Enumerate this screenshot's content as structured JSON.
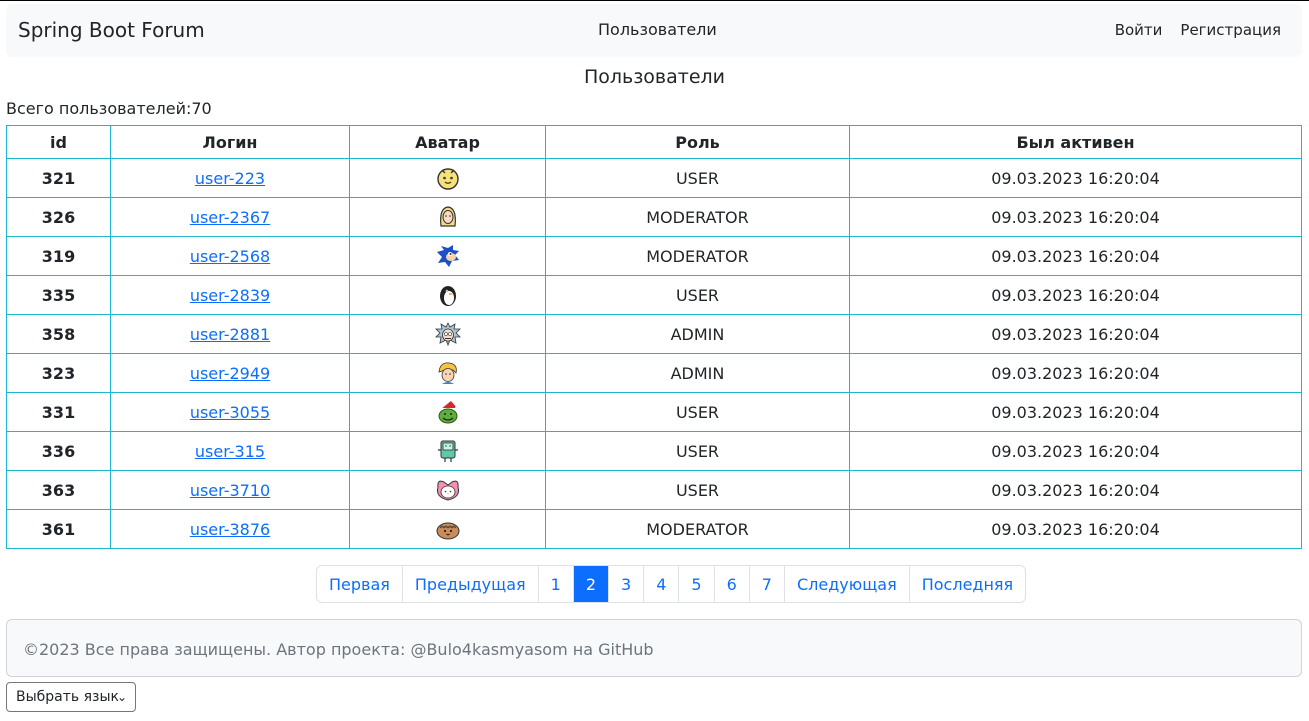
{
  "navbar": {
    "brand": "Spring Boot Forum",
    "center_link": "Пользователи",
    "login": "Войти",
    "register": "Регистрация"
  },
  "page": {
    "title": "Пользователи",
    "total": "Всего пользователей:70"
  },
  "table": {
    "headers": [
      "id",
      "Логин",
      "Аватар",
      "Роль",
      "Был активен"
    ],
    "rows": [
      {
        "id": "321",
        "login": "user-223",
        "avatar": "bt21-chimmy-icon",
        "role": "USER",
        "active": "09.03.2023 16:20:04"
      },
      {
        "id": "326",
        "login": "user-2367",
        "avatar": "blonde-girl-icon",
        "role": "MODERATOR",
        "active": "09.03.2023 16:20:04"
      },
      {
        "id": "319",
        "login": "user-2568",
        "avatar": "sonic-icon",
        "role": "MODERATOR",
        "active": "09.03.2023 16:20:04"
      },
      {
        "id": "335",
        "login": "user-2839",
        "avatar": "penguin-icon",
        "role": "USER",
        "active": "09.03.2023 16:20:04"
      },
      {
        "id": "358",
        "login": "user-2881",
        "avatar": "rick-icon",
        "role": "ADMIN",
        "active": "09.03.2023 16:20:04"
      },
      {
        "id": "323",
        "login": "user-2949",
        "avatar": "blonde-boy-icon",
        "role": "ADMIN",
        "active": "09.03.2023 16:20:04"
      },
      {
        "id": "331",
        "login": "user-3055",
        "avatar": "grinch-icon",
        "role": "USER",
        "active": "09.03.2023 16:20:04"
      },
      {
        "id": "336",
        "login": "user-315",
        "avatar": "bmo-icon",
        "role": "USER",
        "active": "09.03.2023 16:20:04"
      },
      {
        "id": "363",
        "login": "user-3710",
        "avatar": "my-melody-icon",
        "role": "USER",
        "active": "09.03.2023 16:20:04"
      },
      {
        "id": "361",
        "login": "user-3876",
        "avatar": "bt21-shooky-icon",
        "role": "MODERATOR",
        "active": "09.03.2023 16:20:04"
      }
    ]
  },
  "pagination": {
    "first": "Первая",
    "prev": "Предыдущая",
    "pages": [
      "1",
      "2",
      "3",
      "4",
      "5",
      "6",
      "7"
    ],
    "current": "2",
    "next": "Следующая",
    "last": "Последняя"
  },
  "footer": {
    "text": "©2023 Все права защищены. Автор проекта: @Bulo4kasmyasom на GitHub"
  },
  "language_select": {
    "selected": "Выбрать язык"
  },
  "colors": {
    "accent": "#0d6efd",
    "table_border": "#1fb6d0",
    "navbar_bg": "#f8f9fa"
  }
}
